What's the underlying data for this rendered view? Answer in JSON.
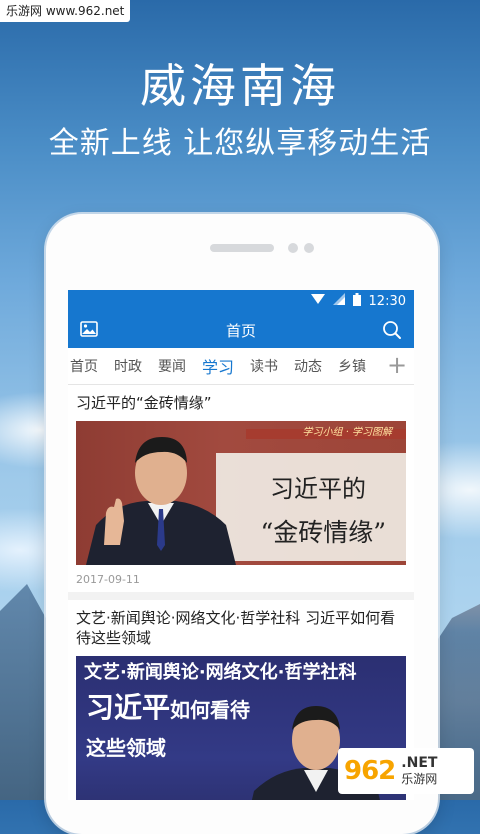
{
  "watermark_top": "乐游网 www.962.net",
  "headline": "威海南海",
  "subline": "全新上线 让您纵享移动生活",
  "status": {
    "time": "12:30"
  },
  "appbar": {
    "title": "首页"
  },
  "tabs": [
    {
      "label": "首页",
      "active": false
    },
    {
      "label": "时政",
      "active": false
    },
    {
      "label": "要闻",
      "active": false
    },
    {
      "label": "学习",
      "active": true
    },
    {
      "label": "读书",
      "active": false
    },
    {
      "label": "动态",
      "active": false
    },
    {
      "label": "乡镇",
      "active": false
    }
  ],
  "articles": [
    {
      "title": "习近平的“金砖情缘”",
      "image_logo": "学习小组 · 学习图解",
      "image_line1": "习近平的",
      "image_line2": "“金砖情缘”",
      "date": "2017-09-11"
    },
    {
      "title": "文艺·新闻舆论·网络文化·哲学社科 习近平如何看待这些领域",
      "image_line1": "文艺·新闻舆论·网络文化·哲学社科",
      "image_line2_big": "习近平",
      "image_line2_small": "如何看待",
      "image_line3": "这些领域"
    }
  ],
  "watermark_962": {
    "number": "962",
    "net": ".NET",
    "name": "乐游网"
  },
  "colors": {
    "primary": "#1677cf",
    "active_tab": "#1677cf"
  }
}
